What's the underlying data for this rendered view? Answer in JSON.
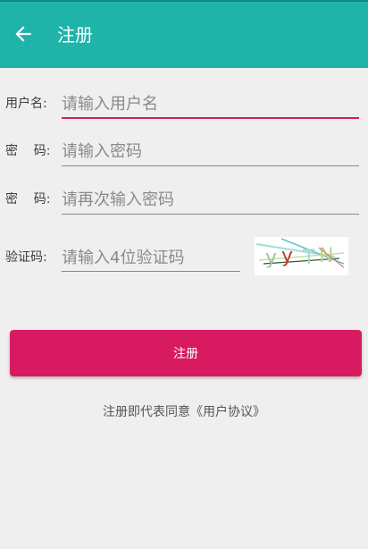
{
  "appbar": {
    "title": "注册",
    "back_icon": "arrow-left-icon",
    "color": "#1fb3a9"
  },
  "form": {
    "username": {
      "label": "用户名:",
      "placeholder": "请输入用户名",
      "value": ""
    },
    "password": {
      "label": "密    码:",
      "placeholder": "请输入密码",
      "value": ""
    },
    "confirm_password": {
      "label": "密    码:",
      "placeholder": "请再次输入密码",
      "value": ""
    },
    "captcha": {
      "label": "验证码:",
      "placeholder": "请输入4位验证码",
      "value": "",
      "image_text": "yyTN"
    }
  },
  "register_button": {
    "label": "注册",
    "color": "#d81b60"
  },
  "agreement_text": "注册即代表同意《用户协议》"
}
